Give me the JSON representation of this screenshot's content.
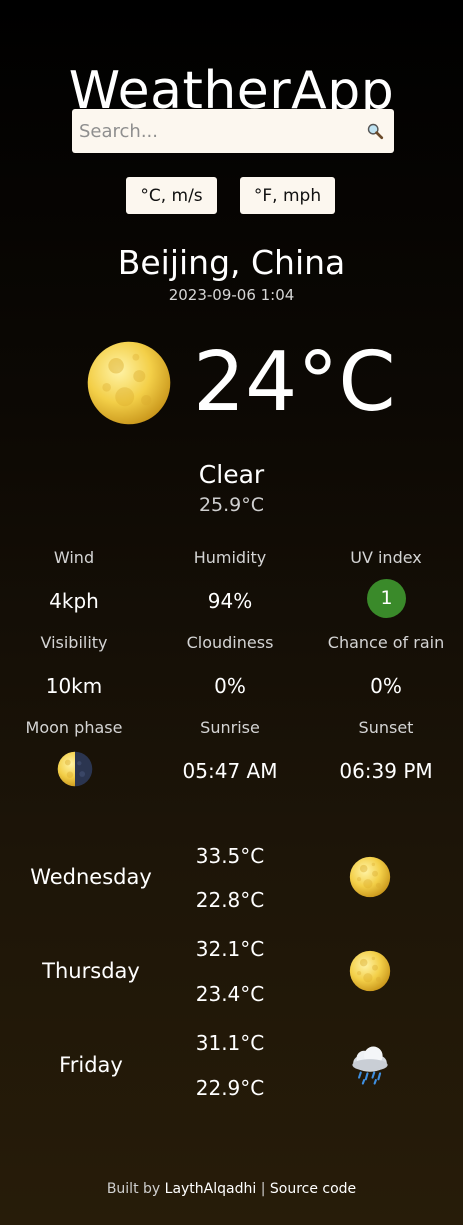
{
  "app": {
    "title": "WeatherApp"
  },
  "search": {
    "placeholder": "Search...",
    "value": ""
  },
  "units": {
    "metric_label": "°C, m/s",
    "imperial_label": "°F, mph"
  },
  "location": {
    "city": "Beijing, China",
    "datetime": "2023-09-06 1:04"
  },
  "current": {
    "icon": "full-moon-icon",
    "temperature": "24°C",
    "condition": "Clear",
    "feels_like": "25.9°C"
  },
  "stats": {
    "wind": {
      "label": "Wind",
      "value": "4kph"
    },
    "humidity": {
      "label": "Humidity",
      "value": "94%"
    },
    "uv": {
      "label": "UV index",
      "value": "1",
      "color": "#3a8a2a"
    },
    "visibility": {
      "label": "Visibility",
      "value": "10km"
    },
    "cloudiness": {
      "label": "Cloudiness",
      "value": "0%"
    },
    "rain": {
      "label": "Chance of rain",
      "value": "0%"
    },
    "moon": {
      "label": "Moon phase",
      "icon": "last-quarter-moon-icon"
    },
    "sunrise": {
      "label": "Sunrise",
      "value": "05:47 AM"
    },
    "sunset": {
      "label": "Sunset",
      "value": "06:39 PM"
    }
  },
  "forecast": [
    {
      "day": "Wednesday",
      "high": "33.5°C",
      "low": "22.8°C",
      "icon": "full-moon-icon"
    },
    {
      "day": "Thursday",
      "high": "32.1°C",
      "low": "23.4°C",
      "icon": "full-moon-icon"
    },
    {
      "day": "Friday",
      "high": "31.1°C",
      "low": "22.9°C",
      "icon": "rain-cloud-icon"
    }
  ],
  "footer": {
    "prefix": "Built by ",
    "author": "LaythAlqadhi",
    "separator": " | ",
    "source": "Source code"
  }
}
